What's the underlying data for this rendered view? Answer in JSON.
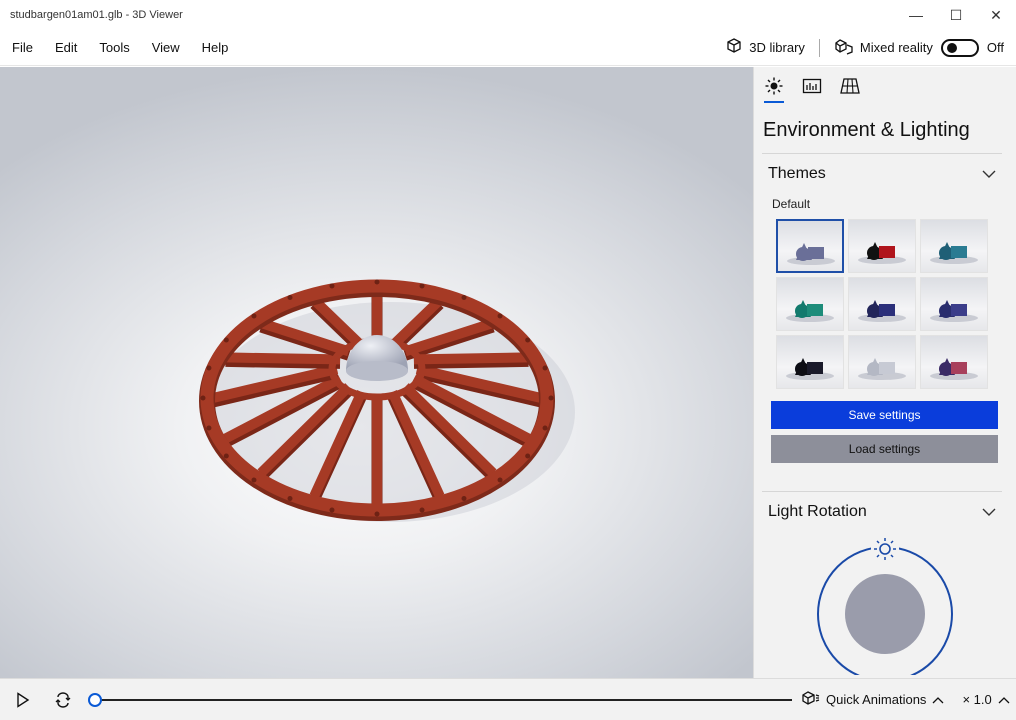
{
  "window": {
    "title": "studbargen01am01.glb - 3D Viewer",
    "minimize_glyph": "—",
    "maximize_glyph": "☐",
    "close_glyph": "✕"
  },
  "menu": {
    "items": [
      "File",
      "Edit",
      "Tools",
      "View",
      "Help"
    ],
    "library_label": "3D library",
    "mixed_reality_label": "Mixed reality",
    "toggle_state": "Off"
  },
  "panel": {
    "heading": "Environment & Lighting",
    "tabs": [
      "sun-icon",
      "stats-icon",
      "grid-icon"
    ],
    "themes": {
      "title": "Themes",
      "selected_label": "Default",
      "items": [
        {
          "name": "theme-default",
          "color": "#6a6f98",
          "accent": "#6a6f98"
        },
        {
          "name": "theme-black-red",
          "color": "#111111",
          "accent": "#b0141c"
        },
        {
          "name": "theme-teal",
          "color": "#1f5f76",
          "accent": "#2a7b92"
        },
        {
          "name": "theme-green",
          "color": "#127a6d",
          "accent": "#1d8c7a"
        },
        {
          "name": "theme-navy",
          "color": "#22255a",
          "accent": "#2b2f7a"
        },
        {
          "name": "theme-indigo",
          "color": "#2a2e6e",
          "accent": "#3b3d8a"
        },
        {
          "name": "theme-black",
          "color": "#0d0d14",
          "accent": "#1a1a2a"
        },
        {
          "name": "theme-silver",
          "color": "#b4b8c4",
          "accent": "#c7cad4"
        },
        {
          "name": "theme-magenta",
          "color": "#3a2a66",
          "accent": "#a8405c"
        }
      ]
    },
    "save_label": "Save settings",
    "load_label": "Load settings",
    "light_rotation_title": "Light Rotation"
  },
  "bottom": {
    "quick_animations_label": "Quick Animations",
    "speed_label": "× 1.0",
    "timeline_progress": 0
  },
  "colors": {
    "accent_blue": "#0a5ad6",
    "save_button": "#0a3ddb",
    "load_button": "#8d8f9a",
    "wheel": "#a63a25",
    "hub": "#c9ccd6"
  }
}
